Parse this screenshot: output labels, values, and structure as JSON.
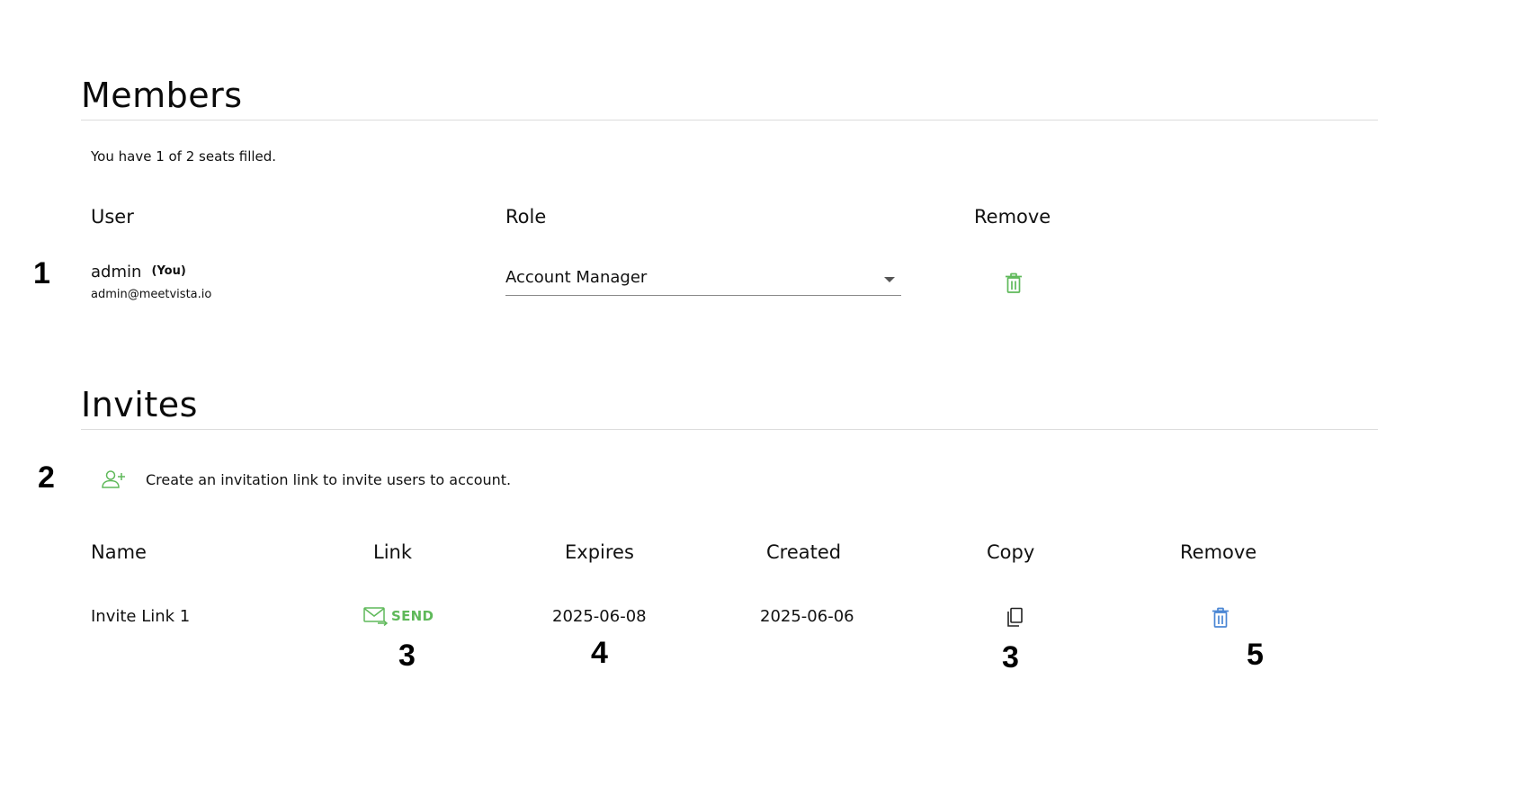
{
  "colors": {
    "green": "#5fb95a",
    "blue": "#4a86d4"
  },
  "members": {
    "title": "Members",
    "seats_text": "You have 1 of 2 seats filled.",
    "headers": {
      "user": "User",
      "role": "Role",
      "remove": "Remove"
    },
    "rows": [
      {
        "name": "admin",
        "you": "(You)",
        "email": "admin@meetvista.io",
        "role": "Account Manager",
        "remove_icon": "trash-icon"
      }
    ]
  },
  "invites": {
    "title": "Invites",
    "create_text": "Create an invitation link to invite users to account.",
    "create_icon": "add-user-icon",
    "headers": {
      "name": "Name",
      "link": "Link",
      "expires": "Expires",
      "created": "Created",
      "copy": "Copy",
      "remove": "Remove"
    },
    "rows": [
      {
        "name": "Invite Link 1",
        "send_label": "SEND",
        "send_icon": "mail-send-icon",
        "expires": "2025-06-08",
        "created": "2025-06-06",
        "copy_icon": "copy-icon",
        "remove_icon": "trash-icon"
      }
    ]
  },
  "markers": {
    "m1": "1",
    "m2": "2",
    "m3a": "3",
    "m4": "4",
    "m3b": "3",
    "m5": "5"
  }
}
